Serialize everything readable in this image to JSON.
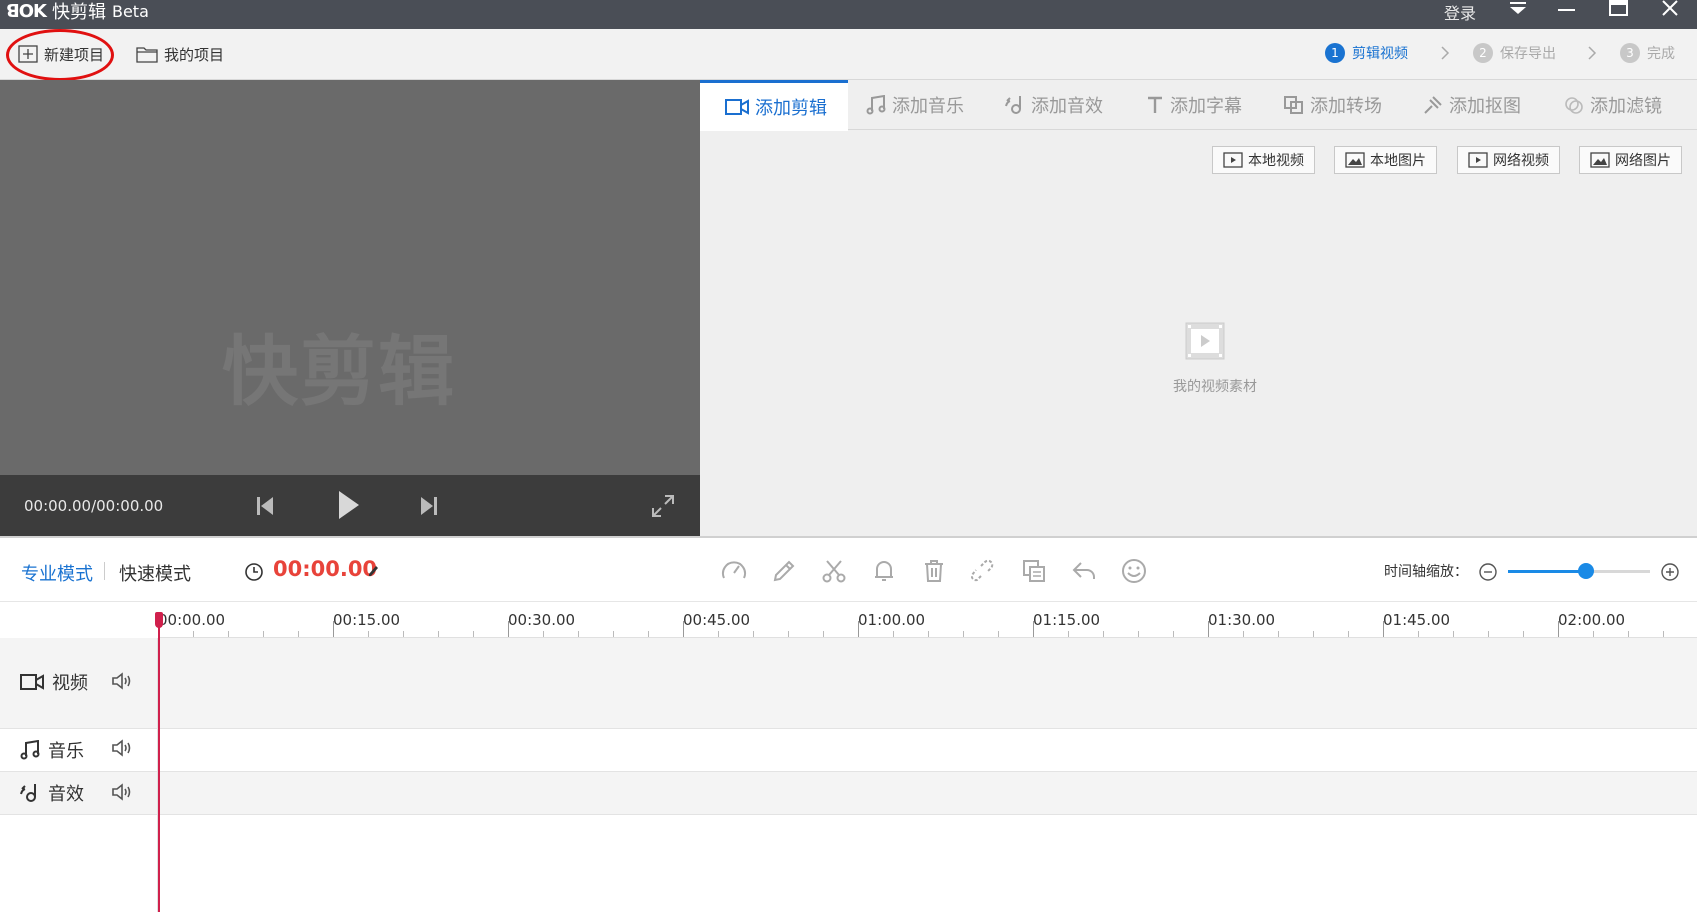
{
  "app": {
    "logo_mark": "ꓭOK",
    "name": "快剪辑",
    "badge": "Beta",
    "login": "登录"
  },
  "toolbar": {
    "new_project": "新建项目",
    "my_projects": "我的项目"
  },
  "steps": [
    {
      "num": "1",
      "label": "剪辑视频",
      "active": true
    },
    {
      "num": "2",
      "label": "保存导出",
      "active": false
    },
    {
      "num": "3",
      "label": "完成",
      "active": false
    }
  ],
  "preview": {
    "watermark": "快剪辑",
    "timecode": "00:00.00/00:00.00"
  },
  "tabs": [
    {
      "label": "添加剪辑",
      "icon": "video-camera-icon",
      "active": true
    },
    {
      "label": "添加音乐",
      "icon": "music-note-icon",
      "active": false
    },
    {
      "label": "添加音效",
      "icon": "sound-effect-icon",
      "active": false
    },
    {
      "label": "添加字幕",
      "icon": "text-t-icon",
      "active": false
    },
    {
      "label": "添加转场",
      "icon": "transition-icon",
      "active": false
    },
    {
      "label": "添加抠图",
      "icon": "magic-pin-icon",
      "active": false
    },
    {
      "label": "添加滤镜",
      "icon": "filter-icon",
      "active": false
    }
  ],
  "sources": [
    {
      "label": "本地视频",
      "icon": "local-video-icon"
    },
    {
      "label": "本地图片",
      "icon": "local-image-icon"
    },
    {
      "label": "网络视频",
      "icon": "web-video-icon"
    },
    {
      "label": "网络图片",
      "icon": "web-image-icon"
    }
  ],
  "media": {
    "empty_label": "我的视频素材"
  },
  "editbar": {
    "mode_pro": "专业模式",
    "mode_fast": "快速模式",
    "current_time": "00:00.00",
    "zoom_label": "时间轴缩放：",
    "zoom_level": 0.55
  },
  "ruler": {
    "labels": [
      "00:00.00",
      "00:15.00",
      "00:30.00",
      "00:45.00",
      "01:00.00",
      "01:15.00",
      "01:30.00",
      "01:45.00",
      "02:00.00"
    ]
  },
  "tracks": [
    {
      "label": "视频",
      "icon": "video-camera-icon"
    },
    {
      "label": "音乐",
      "icon": "music-note-icon"
    },
    {
      "label": "音效",
      "icon": "sound-effect-icon"
    }
  ],
  "colors": {
    "accent": "#1a73d1",
    "time_red": "#e8433a",
    "playhead": "#d0204c",
    "titlebar": "#4a4e56"
  }
}
